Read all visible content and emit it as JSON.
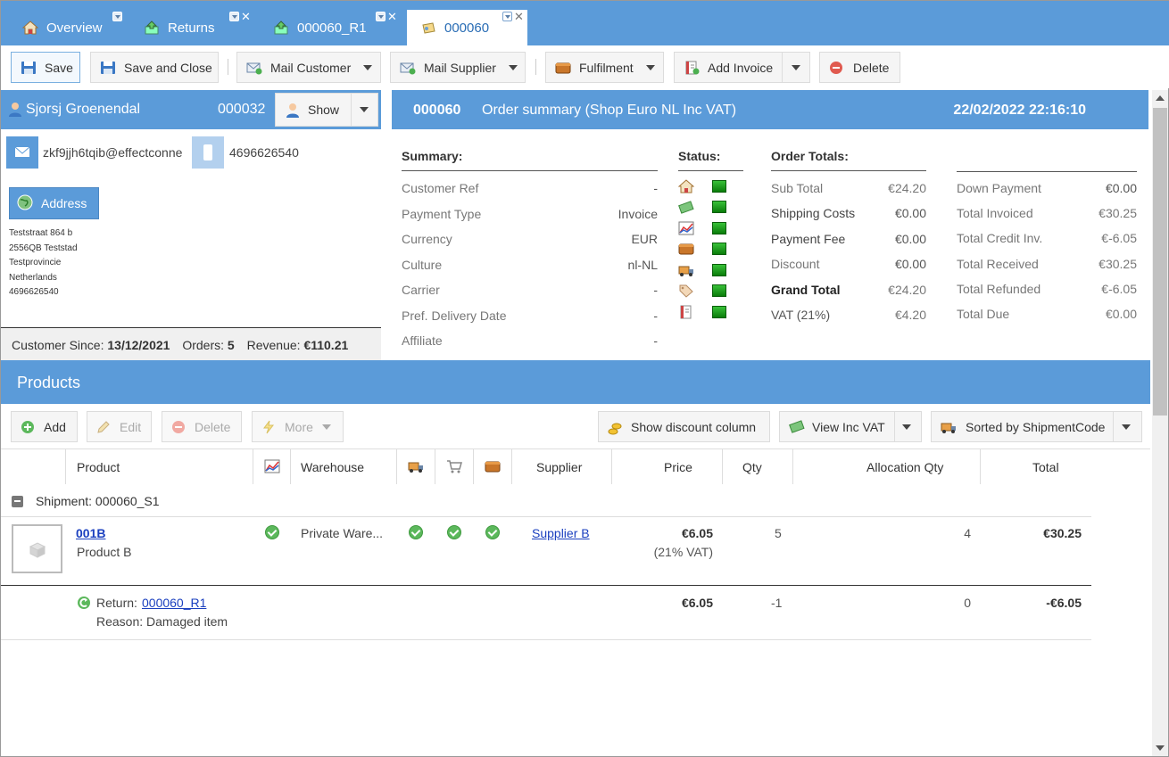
{
  "tabs": [
    {
      "label": "Overview",
      "icon": "home-icon"
    },
    {
      "label": "Returns",
      "icon": "returns-icon"
    },
    {
      "label": "000060_R1",
      "icon": "return-doc-icon"
    },
    {
      "label": "000060",
      "icon": "order-icon"
    }
  ],
  "toolbar": {
    "save": "Save",
    "save_close": "Save and Close",
    "mail_customer": "Mail Customer",
    "mail_supplier": "Mail Supplier",
    "fulfilment": "Fulfilment",
    "add_invoice": "Add Invoice",
    "delete": "Delete"
  },
  "customer": {
    "name": "Sjorsj Groenendal",
    "id": "000032",
    "show": "Show",
    "email": "zkf9jjh6tqib@effectconne",
    "phone": "4696626540",
    "address_button": "Address",
    "address_lines": [
      "Teststraat 864 b",
      "2556QB Teststad",
      "Testprovincie",
      "Netherlands",
      "4696626540"
    ],
    "since_label": "Customer Since:",
    "since": "13/12/2021",
    "orders_label": "Orders:",
    "orders": "5",
    "revenue_label": "Revenue:",
    "revenue": "€110.21"
  },
  "order": {
    "number": "000060",
    "title": "Order summary (Shop Euro NL Inc VAT)",
    "datetime": "22/02/2022 22:16:10"
  },
  "summary": {
    "title": "Summary:",
    "rows": [
      {
        "label": "Customer Ref",
        "value": "-"
      },
      {
        "label": "Payment Type",
        "value": "Invoice"
      },
      {
        "label": "Currency",
        "value": "EUR"
      },
      {
        "label": "Culture",
        "value": "nl-NL"
      },
      {
        "label": "Carrier",
        "value": "-"
      },
      {
        "label": "Pref. Delivery Date",
        "value": "-"
      },
      {
        "label": "Affiliate",
        "value": "-"
      }
    ]
  },
  "status": {
    "title": "Status:",
    "icons": [
      "home-icon",
      "money-icon",
      "chart-icon",
      "box-icon",
      "truck-icon",
      "tag-icon",
      "invoice-icon"
    ]
  },
  "totals": {
    "title": "Order Totals:",
    "left": [
      {
        "label": "Sub Total",
        "value": "€24.20"
      },
      {
        "label": "Shipping Costs",
        "value": "€0.00"
      },
      {
        "label": "Payment Fee",
        "value": "€0.00"
      },
      {
        "label": "Discount",
        "value": "€0.00"
      },
      {
        "label": "Grand Total",
        "value": "€24.20"
      },
      {
        "label": "VAT (21%)",
        "value": "€4.20"
      }
    ],
    "right": [
      {
        "label": "Down Payment",
        "value": "€0.00"
      },
      {
        "label": "Total Invoiced",
        "value": "€30.25"
      },
      {
        "label": "Total Credit Inv.",
        "value": "€-6.05"
      },
      {
        "label": "Total Received",
        "value": "€30.25"
      },
      {
        "label": "Total Refunded",
        "value": "€-6.05"
      },
      {
        "label": "Total Due",
        "value": "€0.00"
      }
    ]
  },
  "products": {
    "title": "Products",
    "add": "Add",
    "edit": "Edit",
    "delete": "Delete",
    "more": "More",
    "show_discount": "Show discount column",
    "view_vat": "View Inc VAT",
    "sorted": "Sorted by ShipmentCode",
    "columns": {
      "product": "Product",
      "warehouse": "Warehouse",
      "supplier": "Supplier",
      "price": "Price",
      "qty": "Qty",
      "allocation": "Allocation Qty",
      "total": "Total"
    },
    "shipment": "Shipment: 000060_S1",
    "item": {
      "code": "001B",
      "name": "Product B",
      "warehouse": "Private Ware...",
      "supplier": "Supplier B",
      "price": "€6.05",
      "vat": "(21% VAT)",
      "qty": "5",
      "allocation": "4",
      "total": "€30.25"
    },
    "return": {
      "label": "Return:",
      "ref": "000060_R1",
      "reason": "Reason: Damaged item",
      "price": "€6.05",
      "qty": "-1",
      "allocation": "0",
      "total": "-€6.05"
    }
  }
}
